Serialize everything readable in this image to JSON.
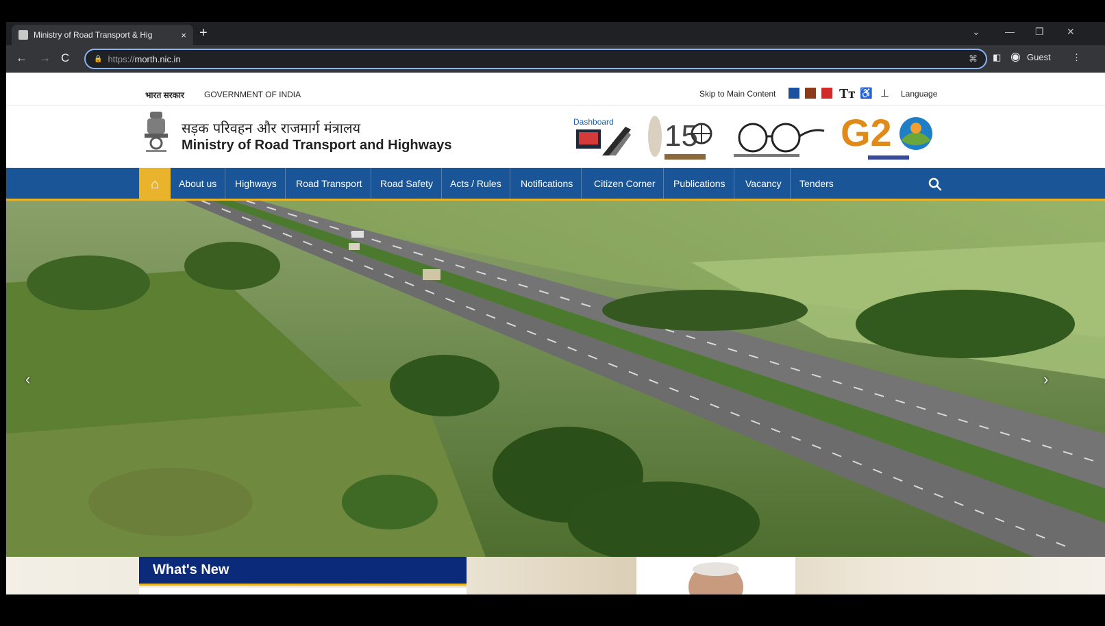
{
  "browser": {
    "tab_title": "Ministry of Road Transport & Hig",
    "tab_close": "×",
    "new_tab": "+",
    "url_scheme": "https://",
    "url_host": "morth.nic.in",
    "profile_label": "Guest"
  },
  "topstrip": {
    "gov_hindi": "भारत सरकार",
    "gov_english": "GOVERNMENT OF INDIA",
    "skip_link": "Skip to Main Content",
    "theme_colors": [
      "#1b4fa0",
      "#8b3a1a",
      "#d42a2a"
    ],
    "text_size_icon": "Tт",
    "language_label": "Language"
  },
  "header": {
    "ministry_hindi": "सड़क परिवहन और राजमार्ग मंत्रालय",
    "ministry_english": "Ministry of Road Transport and Highways",
    "dashboard_label": "Dashboard"
  },
  "nav": {
    "items": [
      "About us",
      "Highways",
      "Road Transport",
      "Road Safety",
      "Acts / Rules",
      "Notifications",
      "Citizen Corner",
      "Publications",
      "Vacancy",
      "Tenders"
    ]
  },
  "hero": {
    "prev_icon": "‹",
    "next_icon": "›"
  },
  "bottom": {
    "whats_new": "What's New"
  },
  "colors": {
    "nav_blue": "#1a5597",
    "accent_gold": "#e9b32b",
    "whats_new_blue": "#0b2a7a"
  }
}
